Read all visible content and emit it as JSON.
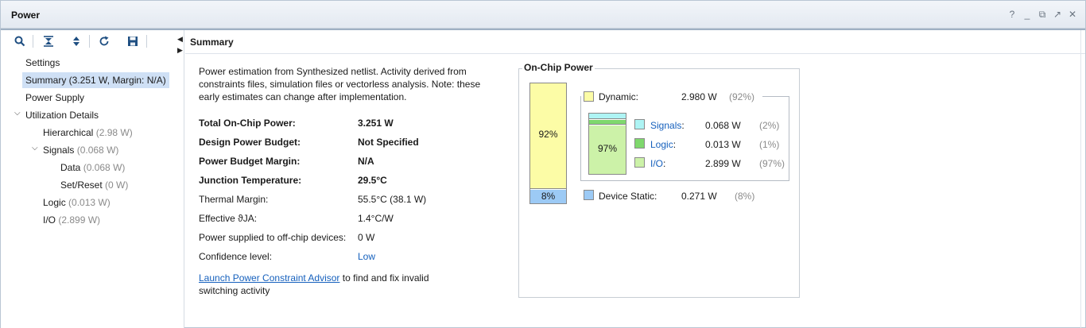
{
  "window": {
    "title": "Power",
    "controls": [
      "?",
      "_",
      "⧉",
      "↗",
      "✕"
    ]
  },
  "toolbar": {
    "icons": [
      "search-icon",
      "collapse-all-icon",
      "expand-all-icon",
      "refresh-icon",
      "save-icon"
    ]
  },
  "tree": {
    "settings": "Settings",
    "summary": "Summary (3.251 W, Margin: N/A)",
    "power_supply": "Power Supply",
    "utilization": "Utilization Details",
    "hierarchical": {
      "label": "Hierarchical",
      "value": "(2.98 W)"
    },
    "signals": {
      "label": "Signals",
      "value": "(0.068 W)"
    },
    "data": {
      "label": "Data",
      "value": "(0.068 W)"
    },
    "set_reset": {
      "label": "Set/Reset",
      "value": "(0 W)"
    },
    "logic": {
      "label": "Logic",
      "value": "(0.013 W)"
    },
    "io": {
      "label": "I/O",
      "value": "(2.899 W)"
    }
  },
  "summary": {
    "header": "Summary",
    "intro": "Power estimation from Synthesized netlist. Activity derived from constraints files, simulation files or vectorless analysis. Note: these early estimates can change after implementation.",
    "rows": [
      {
        "key": "Total On-Chip Power:",
        "value": "3.251 W"
      },
      {
        "key": "Design Power Budget:",
        "value": "Not Specified"
      },
      {
        "key": "Power Budget Margin:",
        "value": "N/A"
      },
      {
        "key": "Junction Temperature:",
        "value": "29.5°C"
      },
      {
        "key": "Thermal Margin:",
        "value": "55.5°C (38.1 W)"
      },
      {
        "key": "Effective ϑJA:",
        "value": "1.4°C/W"
      },
      {
        "key": "Power supplied to off-chip devices:",
        "value": "0 W"
      },
      {
        "key": "Confidence level:",
        "value": "Low"
      }
    ],
    "advisor_link": "Launch Power Constraint Advisor",
    "advisor_text": " to find and fix invalid switching activity"
  },
  "onchip": {
    "title": "On-Chip Power",
    "main_bar": {
      "dynamic_pct_label": "92%",
      "static_pct_label": "8%",
      "dynamic_fraction": 0.92,
      "static_fraction": 0.08
    },
    "dynamic": {
      "name": "Dynamic:",
      "value": "2.980 W",
      "pct": "(92%)"
    },
    "sub_bar": {
      "label": "97%"
    },
    "signals": {
      "name": "Signals",
      "value": "0.068 W",
      "pct": "(2%)"
    },
    "logic": {
      "name": "Logic",
      "value": "0.013 W",
      "pct": "(1%)"
    },
    "io": {
      "name": "I/O",
      "value": "2.899 W",
      "pct": "(97%)"
    },
    "device_static": {
      "name": "Device Static:",
      "value": "0.271 W",
      "pct": "(8%)"
    },
    "colon": ":",
    "colors": {
      "dynamic": "#fcfca6",
      "static": "#9ccaf5",
      "signals": "#aef4f4",
      "logic": "#7fd86d",
      "io": "#ccf2a8"
    }
  }
}
